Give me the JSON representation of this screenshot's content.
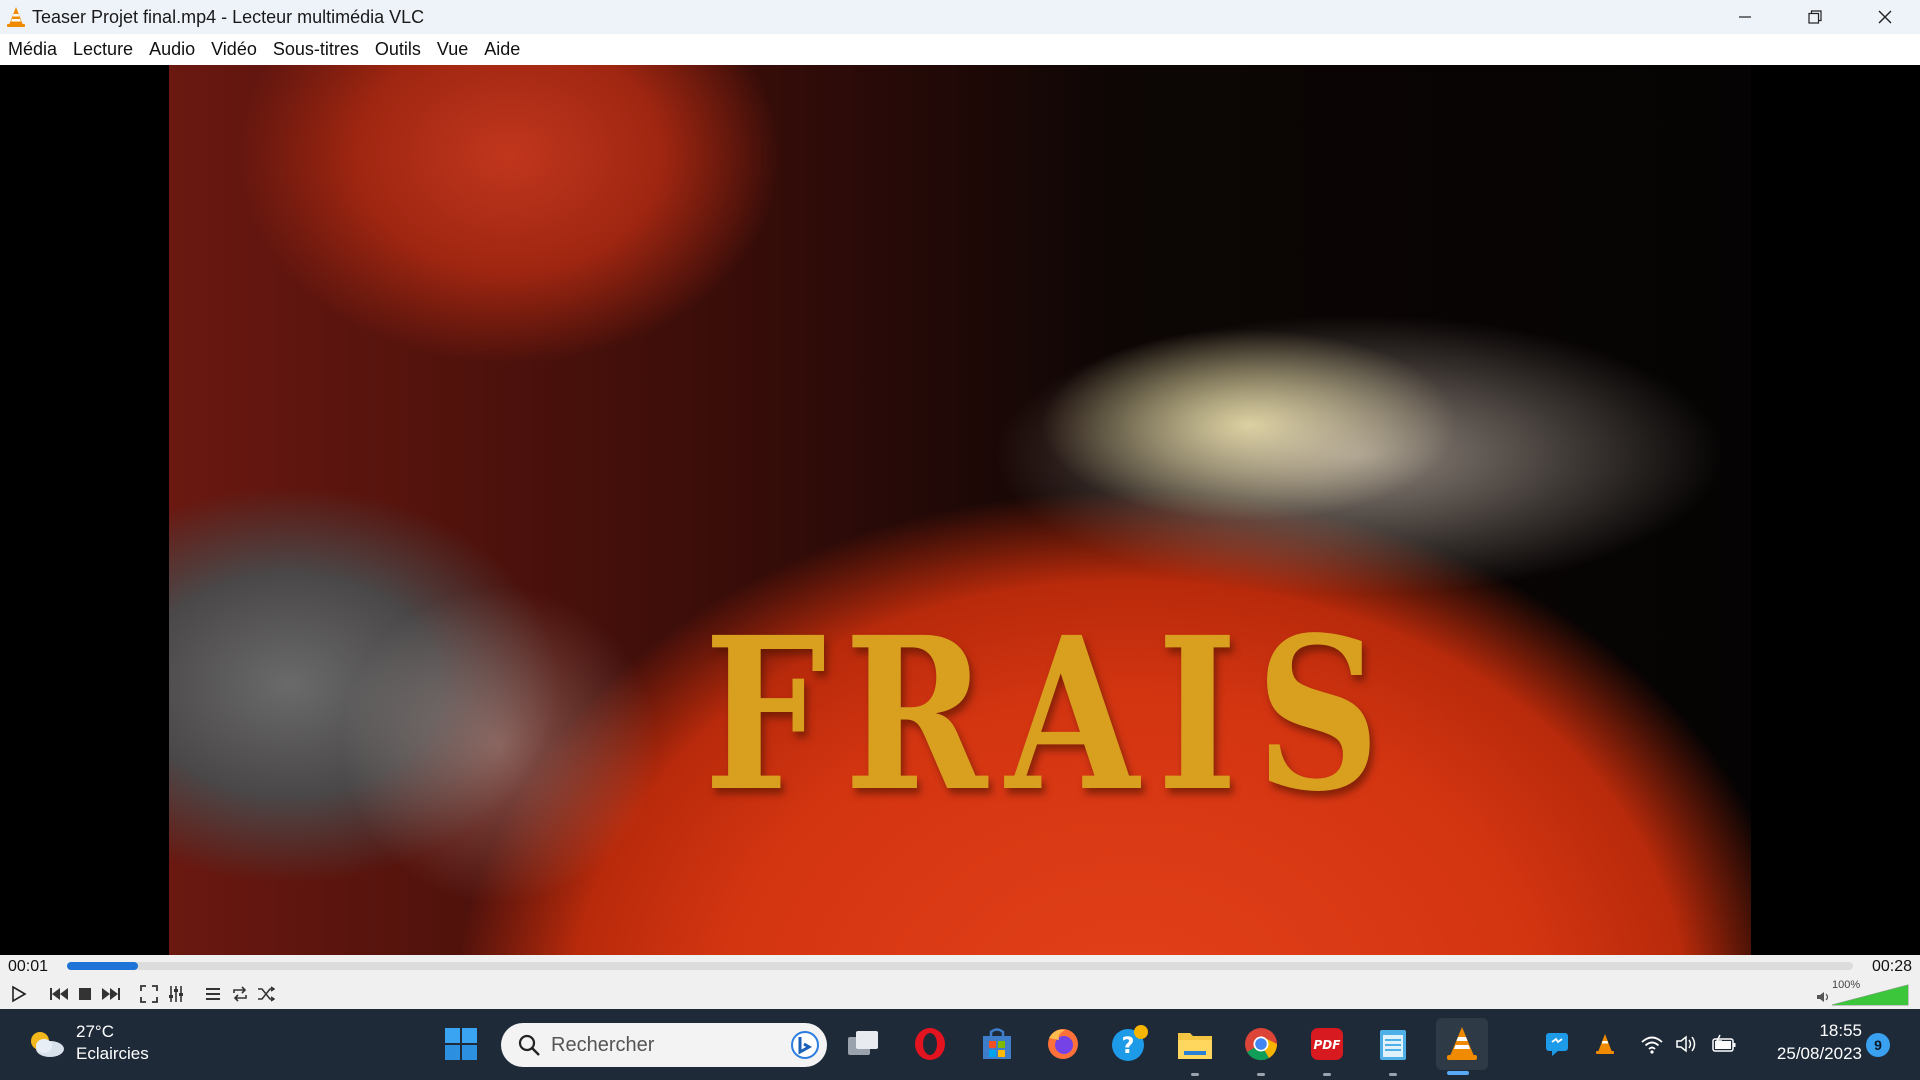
{
  "window": {
    "title": "Teaser Projet final.mp4 - Lecteur multimédia VLC"
  },
  "menu": {
    "items": [
      "Média",
      "Lecture",
      "Audio",
      "Vidéo",
      "Sous-titres",
      "Outils",
      "Vue",
      "Aide"
    ]
  },
  "video": {
    "overlay_text": "FRAIS"
  },
  "playback": {
    "current_time": "00:01",
    "total_time": "00:28",
    "progress": 0.04,
    "volume_label": "100%",
    "volume_level": 1.0
  },
  "controls": {
    "buttons": [
      "play-icon",
      "previous-icon",
      "stop-icon",
      "next-icon",
      "fullscreen-icon",
      "extended-settings-icon",
      "playlist-icon",
      "loop-icon",
      "shuffle-icon"
    ]
  },
  "taskbar": {
    "weather_temp": "27°C",
    "weather_desc": "Eclaircies",
    "search_placeholder": "Rechercher",
    "time": "18:55",
    "date": "25/08/2023",
    "notification_count": "9"
  },
  "colors": {
    "accent": "#1d73d6",
    "taskbar_bg": "#1e2a38",
    "vlc_orange": "#f08a00",
    "frais_gold": "#d9a01f"
  }
}
